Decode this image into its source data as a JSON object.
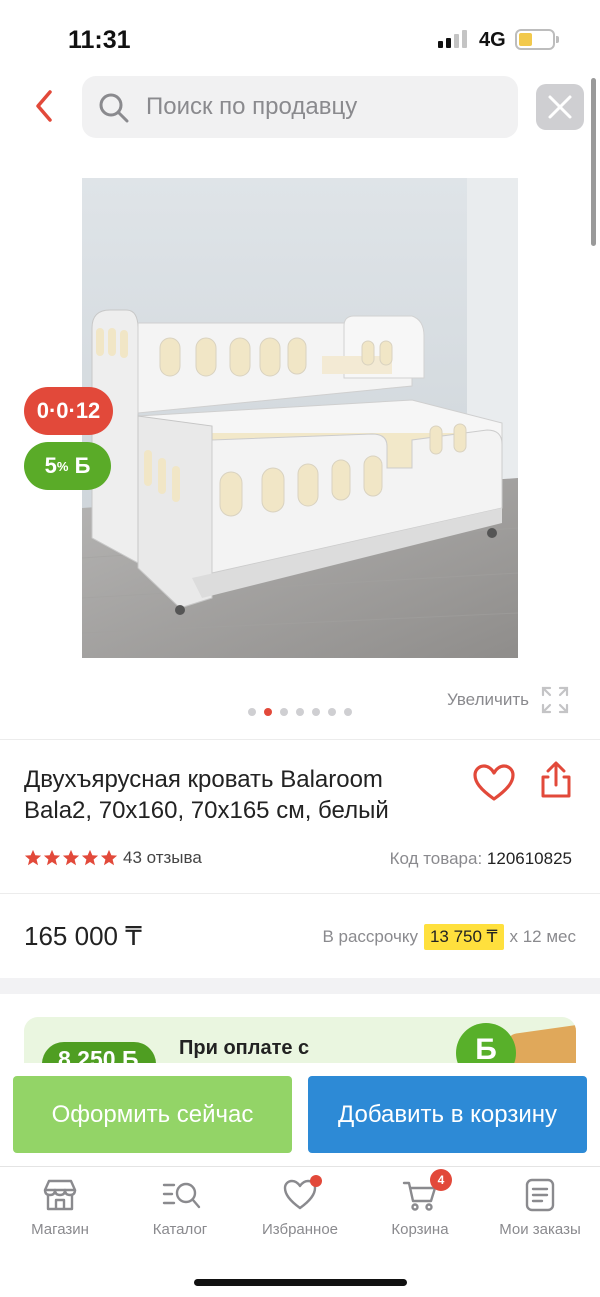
{
  "status_bar": {
    "time": "11:31",
    "network": "4G",
    "battery_level": 0.42
  },
  "search": {
    "placeholder": "Поиск по продавцу",
    "value": ""
  },
  "gallery": {
    "image_count": 7,
    "active_index": 1,
    "zoom_label": "Увеличить"
  },
  "badges": {
    "installment": "0·0·12",
    "bonus_value": "5",
    "bonus_unit": "%",
    "bonus_currency": "Б"
  },
  "product": {
    "title": "Двухъярусная кровать Balaroom Bala2, 70x160, 70x165 см, белый",
    "rating": 5,
    "reviews": "43 отзыва",
    "sku_label": "Код товара:",
    "sku": "120610825",
    "price": "165 000 ₸",
    "installment_prefix": "В рассрочку",
    "installment_amount": "13 750 ₸",
    "installment_suffix": "х 12 мес"
  },
  "promo": {
    "amount": "8 250 Б",
    "text": "При оплате с"
  },
  "actions": {
    "checkout": "Оформить сейчас",
    "add_to_cart": "Добавить в корзину"
  },
  "tabbar": {
    "items": [
      {
        "label": "Магазин",
        "icon": "store-icon"
      },
      {
        "label": "Каталог",
        "icon": "catalog-search-icon"
      },
      {
        "label": "Избранное",
        "icon": "heart-icon",
        "dot": true
      },
      {
        "label": "Корзина",
        "icon": "cart-icon",
        "badge": "4"
      },
      {
        "label": "Мои заказы",
        "icon": "orders-icon"
      }
    ]
  },
  "colors": {
    "accent_red": "#e2493a",
    "bonus_green": "#5aab28",
    "checkout_green": "#93d467",
    "cart_blue": "#2d8ad6",
    "installment_yellow": "#ffe03d"
  }
}
